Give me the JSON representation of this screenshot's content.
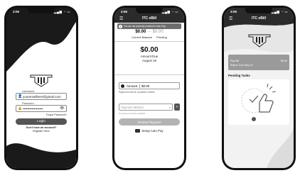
{
  "phones": [
    {
      "status": {
        "time": "3:06",
        "icons": "▂▄▆ ◔ ▭"
      },
      "login": {
        "username_label": "Username",
        "username_value": "youremailhere@gmail.com",
        "password_label": "Password",
        "password_value": "••••••••••••••••••",
        "forgot": "Forgot Password?",
        "login_btn": "Login",
        "no_account": "Don't have an account?",
        "register": "Register Here"
      }
    },
    {
      "status": {
        "time": "4:56",
        "icons": "▂▄▆ ◔ ▭"
      },
      "appbar": {
        "menu": "☰",
        "title": "ITC eBill"
      },
      "banner": {
        "icon": "i",
        "text": "You are not currently enrolled in Auto Pay."
      },
      "balance": {
        "current": "$0.00",
        "separator": "–",
        "pending": "$0.00",
        "current_label": "Current Balance",
        "pending_label": "Pending"
      },
      "due": {
        "amount": "$0.00",
        "label": "Amount Due",
        "date": "August 19"
      },
      "amount_field": {
        "label": "Amount",
        "value": "$0.00"
      },
      "amount_hint": "Payment must be a positive number",
      "payment_method": {
        "placeholder": "Payment Method",
        "chevron": "▾",
        "add": "+"
      },
      "payment_hint": "No payment method available",
      "review_btn": "Review Payment",
      "autopay": "Setup Auto Pay"
    },
    {
      "status": {
        "time": "3:06",
        "icons": "▂▄▆ ◔ ▭"
      },
      "appbar": {
        "menu": "☰",
        "title": "ITC eBill"
      },
      "info": {
        "line1_left": "Pay Bill",
        "line1_right": "$0.00",
        "line2": "Status: Due May 15"
      },
      "pending_tasks": "Pending Tasks"
    }
  ]
}
